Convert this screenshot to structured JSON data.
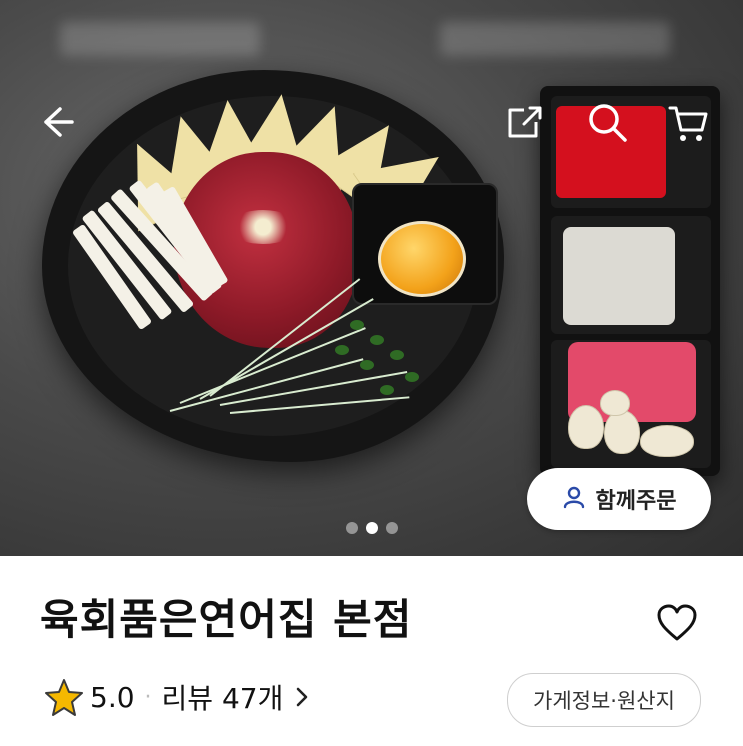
{
  "hero": {
    "image_description_icons": [
      "back-arrow-icon",
      "share-icon",
      "search-icon",
      "cart-icon"
    ],
    "together_order": {
      "label": "함께주문",
      "icon": "person-icon"
    },
    "carousel": {
      "count": 3,
      "active": 2
    }
  },
  "store": {
    "name": "육회품은연어집 본점",
    "rating": "5.0",
    "separator": "·",
    "review_label": "리뷰 47개",
    "info_button": "가게정보·원산지"
  },
  "colors": {
    "star": "#f5b800",
    "text": "#111111",
    "border": "#cfcfcf"
  }
}
